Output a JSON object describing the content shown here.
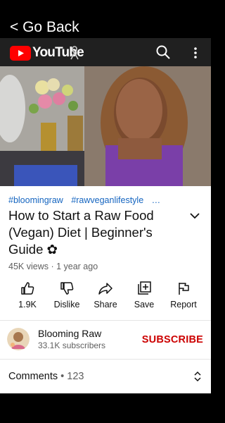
{
  "nav": {
    "back_label": "< Go Back"
  },
  "header": {
    "logo_text": "YouTube",
    "icons": [
      "youtube-logo-icon",
      "awareness-ribbon-icon",
      "search-icon",
      "more-vert-icon"
    ]
  },
  "video": {
    "hashtags": [
      "#bloomingraw",
      "#rawveganlifestyle",
      "…"
    ],
    "title": "How to Start a Raw Food (Vegan) Diet | Beginner's Guide ✿",
    "meta": "45K views · 1 year ago"
  },
  "actions": [
    {
      "label": "1.9K",
      "icon": "thumb-up-icon"
    },
    {
      "label": "Dislike",
      "icon": "thumb-down-icon"
    },
    {
      "label": "Share",
      "icon": "share-icon"
    },
    {
      "label": "Save",
      "icon": "add-to-playlist-icon"
    },
    {
      "label": "Report",
      "icon": "flag-icon"
    }
  ],
  "channel": {
    "name": "Blooming Raw",
    "subscribers": "33.1K subscribers",
    "subscribe_label": "SUBSCRIBE"
  },
  "comments": {
    "label": "Comments",
    "separator": " • ",
    "count": "123"
  },
  "colors": {
    "accent_red": "#cc0000",
    "link_blue": "#1565c0",
    "header_bg": "#202020",
    "youtube_red": "#ff0000"
  }
}
